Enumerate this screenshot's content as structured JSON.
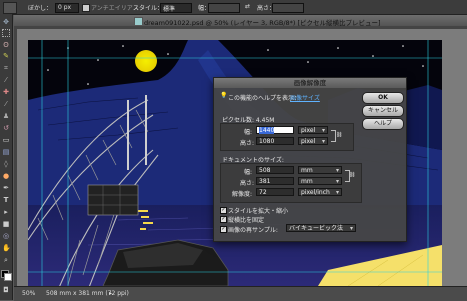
{
  "options_bar": {
    "feather_label": "ぼかし：",
    "feather_value": "0 px",
    "antialias_label": "アンチエイリアス",
    "style_label": "スタイル：",
    "style_value": "標準",
    "width_label": "幅：",
    "height_label": "高さ："
  },
  "document": {
    "title": "dream091022.psd @ 50% (レイヤー 3, RGB/8*) [ピクセル縦横比プレビュー]",
    "zoom": "50%",
    "doc_info": "508 mm x 381 mm (72 ppi)"
  },
  "dialog": {
    "title": "画像解像度",
    "help_text": "この機能のヘルプを表示：",
    "help_link": "画像サイズ",
    "ok_label": "OK",
    "cancel_label": "キャンセル",
    "help_button_label": "ヘルプ",
    "pixel_section_label": "ピクセル数: 4.45M",
    "pixel_width_label": "幅:",
    "pixel_width_value": "1440",
    "pixel_width_unit": "pixel",
    "pixel_height_label": "高さ:",
    "pixel_height_value": "1080",
    "pixel_height_unit": "pixel",
    "doc_section_label": "ドキュメントのサイズ:",
    "doc_width_label": "幅:",
    "doc_width_value": "508",
    "doc_width_unit": "mm",
    "doc_height_label": "高さ:",
    "doc_height_value": "381",
    "doc_height_unit": "mm",
    "resolution_label": "解像度:",
    "resolution_value": "72",
    "resolution_unit": "pixel/inch",
    "scale_styles_label": "スタイルを拡大・縮小",
    "constrain_label": "縦横比を固定",
    "resample_label": "画像の再サンプル:",
    "resample_value": "バイキュービック法"
  },
  "colors": {
    "accent": "#3a6ad8",
    "link": "#5fb3ff",
    "moon": "#f2e000",
    "yellow_block": "#f5e06a"
  }
}
